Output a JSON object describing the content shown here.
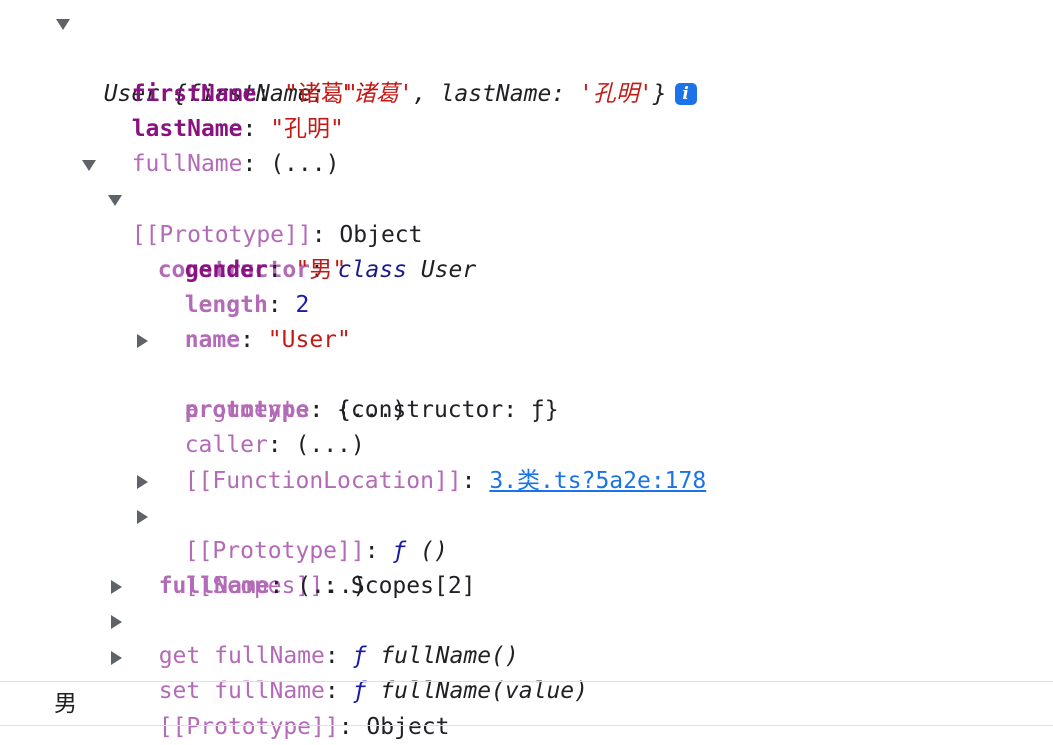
{
  "summary": {
    "class_name": "User",
    "open_brace": " {",
    "k1": "firstName",
    "colon1": ": ",
    "v1": "'诸葛'",
    "comma": ", ",
    "k2": "lastName",
    "colon2": ": ",
    "v2": "'孔明'",
    "close_brace": "}",
    "info_icon_glyph": "i"
  },
  "colon": ": ",
  "rows": [
    {
      "key": "firstName",
      "value": "\"诸葛\""
    },
    {
      "key": "lastName",
      "value": "\"孔明\""
    },
    {
      "key": "fullName",
      "value": "(...)"
    },
    {
      "key": "[[Prototype]]",
      "value": "Object"
    },
    {
      "key": "constructor",
      "value_kw": "class",
      "value": " User"
    },
    {
      "key": "gender",
      "value": "\"男\""
    },
    {
      "key": "length",
      "value": "2"
    },
    {
      "key": "name",
      "value": "\"User\""
    },
    {
      "key": "prototype",
      "value": "{constructor: ƒ}"
    },
    {
      "key": "arguments",
      "value": "(...)"
    },
    {
      "key": "caller",
      "value": "(...)"
    },
    {
      "key": "[[FunctionLocation]]",
      "value": "3.类.ts?5a2e:178"
    },
    {
      "key": "[[Prototype]]",
      "value_f": "ƒ",
      "value": " ()"
    },
    {
      "key": "[[Scopes]]",
      "value": "Scopes[2]"
    },
    {
      "key": "fullName",
      "value": "(...)"
    },
    {
      "key": "get fullName",
      "value_f": "ƒ",
      "value": " fullName()"
    },
    {
      "key": "set fullName",
      "value_f": "ƒ",
      "value": " fullName(value)"
    },
    {
      "key": "[[Prototype]]",
      "value": "Object"
    }
  ],
  "console_output": "男"
}
